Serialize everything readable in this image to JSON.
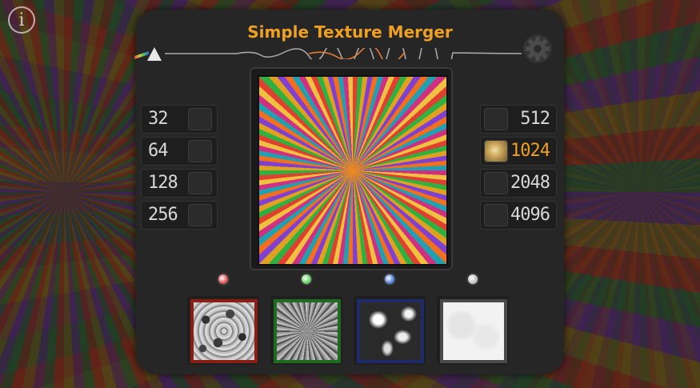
{
  "app": {
    "title": "Simple Texture Merger",
    "accent_color": "#f0a020"
  },
  "header": {
    "info_icon": "info-icon",
    "info_glyph": "i",
    "settings_icon": "gear-icon"
  },
  "resolutions_left": [
    {
      "label": "32",
      "checked": false
    },
    {
      "label": "64",
      "checked": false
    },
    {
      "label": "128",
      "checked": false
    },
    {
      "label": "256",
      "checked": false
    }
  ],
  "resolutions_right": [
    {
      "label": "512",
      "checked": false
    },
    {
      "label": "1024",
      "checked": true
    },
    {
      "label": "2048",
      "checked": false
    },
    {
      "label": "4096",
      "checked": false
    }
  ],
  "channels": [
    {
      "name": "red",
      "led_color": "#e05050",
      "border_color": "#8a1e14"
    },
    {
      "name": "green",
      "led_color": "#60d060",
      "border_color": "#1e6a1e"
    },
    {
      "name": "blue",
      "led_color": "#5080e0",
      "border_color": "#1e2a6a"
    },
    {
      "name": "alpha",
      "led_color": "#c0c0c0",
      "border_color": "#4a4a4a"
    }
  ]
}
